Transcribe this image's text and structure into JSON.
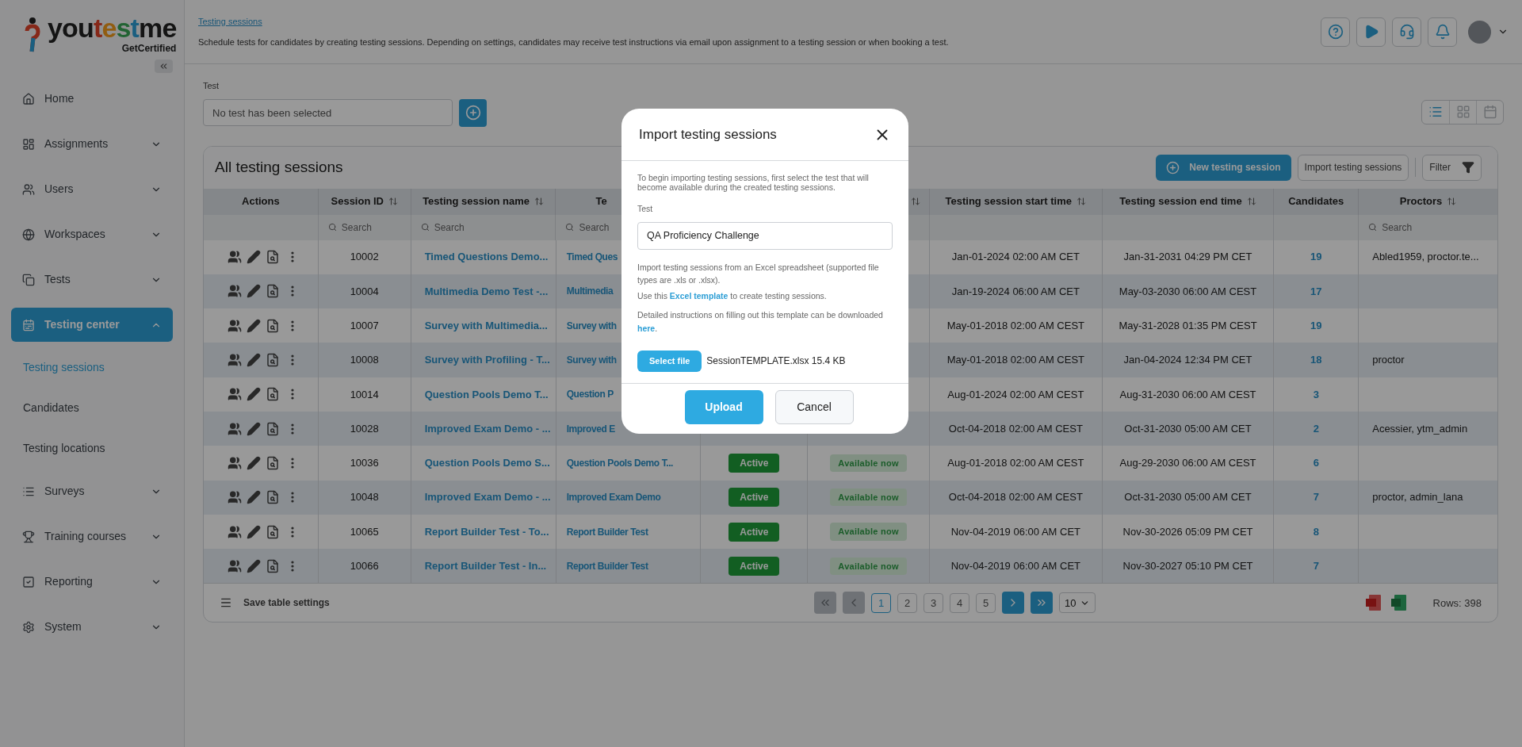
{
  "logo": {
    "text": "youtestme",
    "tagline": "GetCertified"
  },
  "sidebar": {
    "items": [
      {
        "label": "Home",
        "selected": false
      },
      {
        "label": "Assignments",
        "expanded": false,
        "selected": false
      },
      {
        "label": "Users",
        "expanded": false,
        "selected": false
      },
      {
        "label": "Workspaces",
        "expanded": false,
        "selected": false
      },
      {
        "label": "Tests",
        "expanded": false,
        "selected": false
      },
      {
        "label": "Testing center",
        "expanded": true,
        "selected": true,
        "children": [
          {
            "label": "Testing sessions",
            "selected": true
          },
          {
            "label": "Candidates",
            "selected": false
          },
          {
            "label": "Testing locations",
            "selected": false
          }
        ]
      },
      {
        "label": "Surveys",
        "expanded": false,
        "selected": false
      },
      {
        "label": "Training courses",
        "expanded": false,
        "selected": false
      },
      {
        "label": "Reporting",
        "expanded": false,
        "selected": false
      },
      {
        "label": "System",
        "expanded": false,
        "selected": false
      }
    ]
  },
  "header": {
    "breadcrumb": "Testing sessions",
    "description": "Schedule tests for candidates by creating testing sessions. Depending on settings, candidates may receive test instructions via email upon assignment to a testing session or when booking a test."
  },
  "test_picker": {
    "label": "Test",
    "placeholder": "No test has been selected"
  },
  "views": [
    {
      "selected": true
    },
    {
      "selected": false
    },
    {
      "selected": false
    }
  ],
  "card": {
    "title": "All testing sessions",
    "buttons": [
      "New testing session",
      "Import testing sessions",
      "Filter"
    ]
  },
  "table": {
    "columns": [
      {
        "label": "Actions"
      },
      {
        "label": "Session ID",
        "sortable": true,
        "search": "Search"
      },
      {
        "label": "Testing session name",
        "sortable": true,
        "search": "Search"
      },
      {
        "label": "Te",
        "search": "Search"
      },
      {},
      {
        "sortable": true
      },
      {
        "label": "Testing session start time",
        "sortable": true
      },
      {
        "label": "Testing session end time",
        "sortable": true
      },
      {
        "label": "Candidates"
      },
      {
        "label": "Proctors",
        "sortable": true,
        "search": "Search"
      }
    ],
    "rows": [
      {
        "id": "10002",
        "name": "Timed Questions Demo...",
        "test": "Timed Ques",
        "start": "Jan-01-2024 02:00 AM CET",
        "end": "Jan-31-2031 04:29 PM CET",
        "candidates": "19",
        "proctors": "Abled1959, proctor.te..."
      },
      {
        "id": "10004",
        "name": "Multimedia Demo Test -...",
        "test": "Multimedia",
        "start": "Jan-19-2024 06:00 AM CET",
        "end": "May-03-2030 06:00 AM CEST",
        "candidates": "17"
      },
      {
        "id": "10007",
        "name": "Survey with Multimedia...",
        "test": "Survey with",
        "start": "May-01-2018 02:00 AM CEST",
        "end": "May-31-2028 01:35 PM CEST",
        "candidates": "19"
      },
      {
        "id": "10008",
        "name": "Survey with Profiling - T...",
        "test": "Survey with",
        "start": "May-01-2018 02:00 AM CEST",
        "end": "Jan-04-2024 12:34 PM CET",
        "candidates": "18",
        "proctors": "proctor"
      },
      {
        "id": "10014",
        "name": "Question Pools Demo T...",
        "test": "Question P",
        "start": "Aug-01-2024 02:00 AM CEST",
        "end": "Aug-31-2030 06:00 AM CEST",
        "candidates": "3"
      },
      {
        "id": "10028",
        "name": "Improved Exam Demo - ...",
        "test": "Improved E",
        "start": "Oct-04-2018 02:00 AM CEST",
        "end": "Oct-31-2030 05:00 AM CET",
        "candidates": "2",
        "proctors": "Acessier, ytm_admin"
      },
      {
        "id": "10036",
        "name": "Question Pools Demo S...",
        "test": "Question Pools Demo T...",
        "status": "Active",
        "availability": "Available now",
        "start": "Aug-01-2018 02:00 AM CEST",
        "end": "Aug-29-2030 06:00 AM CEST",
        "candidates": "6"
      },
      {
        "id": "10048",
        "name": "Improved Exam Demo - ...",
        "test": "Improved Exam Demo",
        "status": "Active",
        "availability": "Available now",
        "start": "Oct-04-2018 02:00 AM CEST",
        "end": "Oct-31-2030 05:00 AM CET",
        "candidates": "7",
        "proctors": "proctor, admin_lana"
      },
      {
        "id": "10065",
        "name": "Report Builder Test - To...",
        "test": "Report Builder Test",
        "status": "Active",
        "availability": "Available now",
        "start": "Nov-04-2019 06:00 AM CET",
        "end": "Nov-30-2026 05:09 PM CET",
        "candidates": "8"
      },
      {
        "id": "10066",
        "name": "Report Builder Test - In...",
        "test": "Report Builder Test",
        "status": "Active",
        "availability": "Available now",
        "start": "Nov-04-2019 06:00 AM CET",
        "end": "Nov-30-2027 05:10 PM CET",
        "candidates": "7"
      }
    ]
  },
  "footer": {
    "save": "Save table settings",
    "first_disabled": true,
    "prev_disabled": true,
    "next_disabled": false,
    "last_disabled": false,
    "pages": [
      {
        "label": "1",
        "selected": true
      },
      {
        "label": "2",
        "selected": false
      },
      {
        "label": "3",
        "selected": false
      },
      {
        "label": "4",
        "selected": false
      },
      {
        "label": "5",
        "selected": false
      }
    ],
    "page_size": "10",
    "rows": "Rows: 398"
  },
  "modal": {
    "title": "Import testing sessions",
    "intro": "To begin importing testing sessions, first select the test that will become available during the created testing sessions.",
    "test_label": "Test",
    "test_value": "QA Proficiency Challenge",
    "supported": "Import testing sessions from an Excel spreadsheet (supported file types are .xls or .xlsx).",
    "template": {
      "before": "Use this",
      "link": "Excel template",
      "after": "to create testing sessions."
    },
    "instructions": {
      "before": "Detailed instructions on filling out this template can be downloaded",
      "link": "here",
      "after": "."
    },
    "select_file": "Select file",
    "file": "SessionTEMPLATE.xlsx 15.4 KB",
    "upload": "Upload",
    "cancel": "Cancel"
  }
}
